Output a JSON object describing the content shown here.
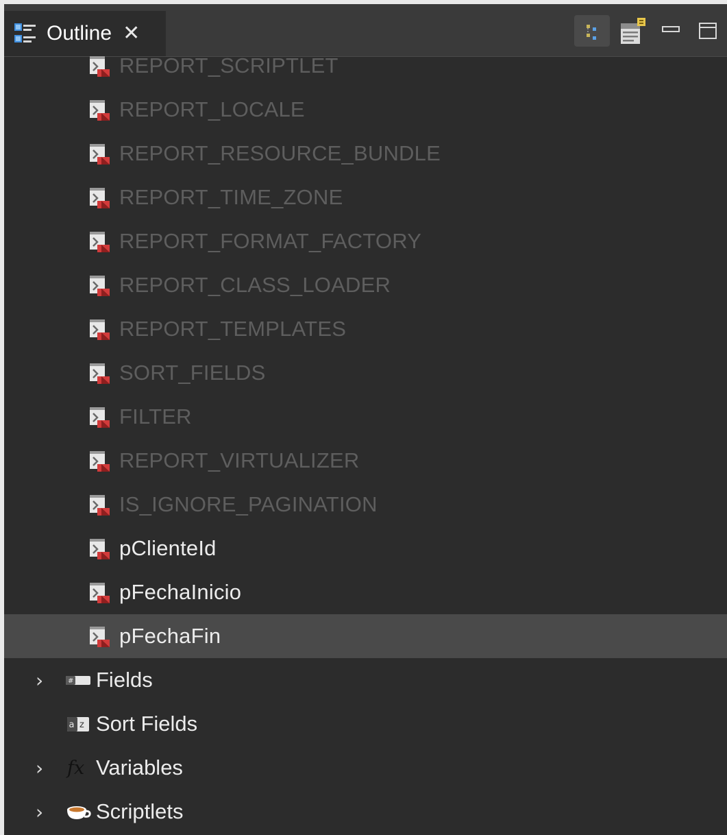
{
  "view": {
    "tab_title": "Outline",
    "close_glyph": "✕"
  },
  "parameters": [
    {
      "label": "REPORT_SCRIPTLET",
      "builtin": true
    },
    {
      "label": "REPORT_LOCALE",
      "builtin": true
    },
    {
      "label": "REPORT_RESOURCE_BUNDLE",
      "builtin": true
    },
    {
      "label": "REPORT_TIME_ZONE",
      "builtin": true
    },
    {
      "label": "REPORT_FORMAT_FACTORY",
      "builtin": true
    },
    {
      "label": "REPORT_CLASS_LOADER",
      "builtin": true
    },
    {
      "label": "REPORT_TEMPLATES",
      "builtin": true
    },
    {
      "label": "SORT_FIELDS",
      "builtin": true
    },
    {
      "label": "FILTER",
      "builtin": true
    },
    {
      "label": "REPORT_VIRTUALIZER",
      "builtin": true
    },
    {
      "label": "IS_IGNORE_PAGINATION",
      "builtin": true
    },
    {
      "label": "pClienteId",
      "builtin": false
    },
    {
      "label": "pFechaInicio",
      "builtin": false
    },
    {
      "label": "pFechaFin",
      "builtin": false,
      "selected": true
    }
  ],
  "nodes": [
    {
      "label": "Fields",
      "expandable": true,
      "icon": "fields-icon"
    },
    {
      "label": "Sort Fields",
      "expandable": false,
      "icon": "sort-fields-icon"
    },
    {
      "label": "Variables",
      "expandable": true,
      "icon": "variables-icon"
    },
    {
      "label": "Scriptlets",
      "expandable": true,
      "icon": "scriptlets-icon"
    }
  ],
  "colors": {
    "panel_bg": "#2c2c2c",
    "selection": "#4a4a4a",
    "text": "#ececec",
    "muted_text": "#5e5e5e"
  }
}
